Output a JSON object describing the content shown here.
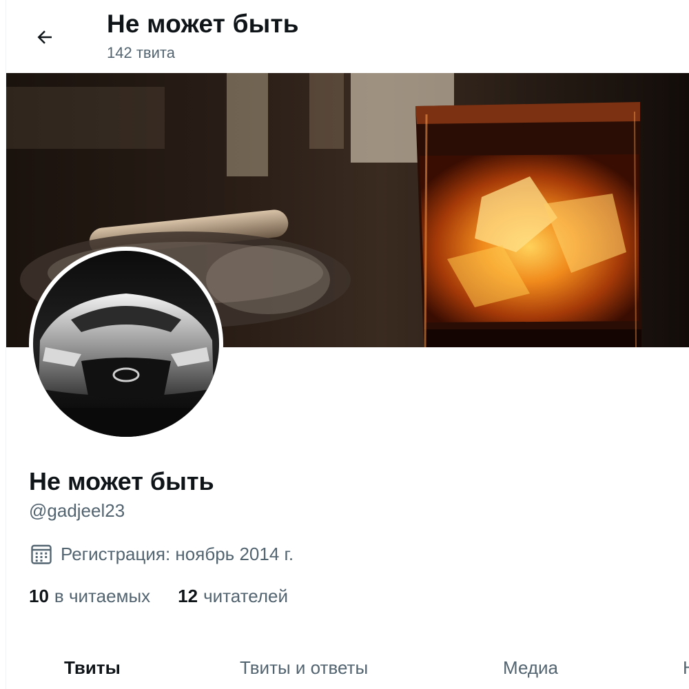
{
  "header": {
    "back_icon": "arrow-left-icon",
    "title": "Не может быть",
    "tweet_count": "142 твита"
  },
  "profile": {
    "display_name": "Не может быть",
    "handle": "@gadjeel23",
    "join_icon": "calendar-icon",
    "join_text": "Регистрация: ноябрь 2014 г.",
    "following_count": "10",
    "following_label": "в читаемых",
    "followers_count": "12",
    "followers_label": "читателей"
  },
  "tabs": [
    {
      "label": "Твиты",
      "active": true
    },
    {
      "label": "Твиты и ответы",
      "active": false
    },
    {
      "label": "Медиа",
      "active": false
    },
    {
      "label": "Н",
      "active": false
    }
  ],
  "colors": {
    "text_primary": "#0f1419",
    "text_secondary": "#536471",
    "divider": "#eff3f4"
  }
}
